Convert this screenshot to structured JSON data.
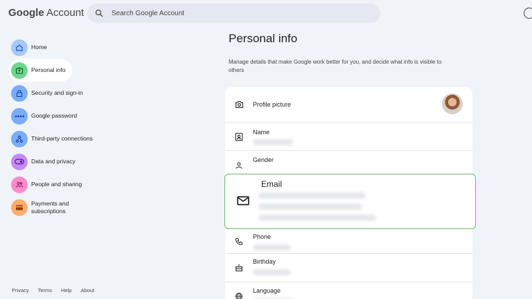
{
  "header": {
    "brand_google": "Google",
    "brand_account": " Account",
    "search_placeholder": "Search Google Account"
  },
  "nav": {
    "items": [
      {
        "label": "Home",
        "icon": "home-icon",
        "color": "#a8c7fa",
        "active": false
      },
      {
        "label": "Personal info",
        "icon": "id-card-icon",
        "color": "#6dd58c",
        "active": true
      },
      {
        "label": "Security and sign-in",
        "icon": "lock-icon",
        "color": "#7cacf8",
        "active": false
      },
      {
        "label": "Google password",
        "icon": "password-dots-icon",
        "color": "#7cacf8",
        "active": false
      },
      {
        "label": "Third-party connections",
        "icon": "connections-icon",
        "color": "#7cacf8",
        "active": false
      },
      {
        "label": "Data and privacy",
        "icon": "toggle-icon",
        "color": "#c58af9",
        "active": false
      },
      {
        "label": "People and sharing",
        "icon": "people-icon",
        "color": "#ff8bcb",
        "active": false
      },
      {
        "label": "Payments and subscriptions",
        "icon": "credit-card-icon",
        "color": "#fcad70",
        "active": false
      }
    ]
  },
  "footer": {
    "links": [
      "Privacy",
      "Terms",
      "Help",
      "About"
    ]
  },
  "main": {
    "title": "Personal info",
    "description": "Manage details that make Google work better for you, and decide what info is visible to others",
    "rows": {
      "profile_picture": "Profile picture",
      "name": "Name",
      "gender": "Gender",
      "email": "Email",
      "phone": "Phone",
      "birthday": "Birthday",
      "language": "Language"
    }
  },
  "colors": {
    "background": "#f0f4f9",
    "highlight_border": "#6fb665"
  }
}
